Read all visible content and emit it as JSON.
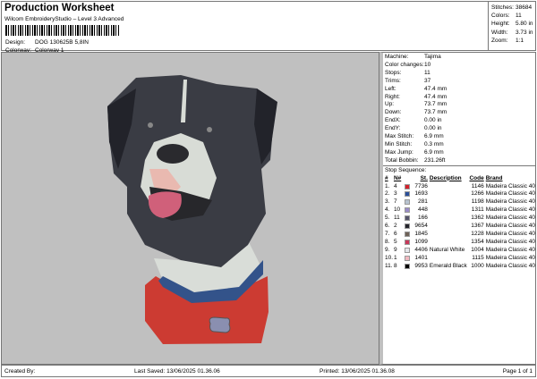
{
  "header": {
    "title": "Production Worksheet",
    "subtitle": "Wilcom EmbroideryStudio – Level 3 Advanced",
    "design_label": "Design:",
    "design_value": "DOG 130625B 5,8IN",
    "colorway_label": "Colorway:",
    "colorway_value": "Colorway 1"
  },
  "info": [
    {
      "k": "Stitches:",
      "v": "38684"
    },
    {
      "k": "Colors:",
      "v": "11"
    },
    {
      "k": "Height:",
      "v": "5.80 in"
    },
    {
      "k": "Width:",
      "v": "3.73 in"
    },
    {
      "k": "Zoom:",
      "v": "1:1"
    }
  ],
  "props": [
    {
      "k": "Machine:",
      "v": "Tajima"
    },
    {
      "k": "Color changes:",
      "v": "10"
    },
    {
      "k": "Stops:",
      "v": "11"
    },
    {
      "k": "Trims:",
      "v": "37"
    },
    {
      "k": "Left:",
      "v": "47.4 mm"
    },
    {
      "k": "Right:",
      "v": "47.4 mm"
    },
    {
      "k": "Up:",
      "v": "73.7 mm"
    },
    {
      "k": "Down:",
      "v": "73.7 mm"
    },
    {
      "k": "EndX:",
      "v": "0.00 in"
    },
    {
      "k": "EndY:",
      "v": "0.00 in"
    },
    {
      "k": "Max Stitch:",
      "v": "6.9 mm"
    },
    {
      "k": "Min Stitch:",
      "v": "0.3 mm"
    },
    {
      "k": "Max Jump:",
      "v": "6.9 mm"
    },
    {
      "k": "Total Bobbin:",
      "v": "231.26ft"
    }
  ],
  "stop_sequence": {
    "title": "Stop Sequence:",
    "headers": [
      "#",
      "N#",
      "St.",
      "Description",
      "Code",
      "Brand"
    ],
    "rows": [
      {
        "n": "1.",
        "nn": "4",
        "color": "#d4202a",
        "st": "7736",
        "desc": "",
        "code": "1146",
        "brand": "Madeira Classic 40"
      },
      {
        "n": "2.",
        "nn": "3",
        "color": "#2a4f9a",
        "st": "1693",
        "desc": "",
        "code": "1266",
        "brand": "Madeira Classic 40"
      },
      {
        "n": "3.",
        "nn": "7",
        "color": "#b8c4d0",
        "st": "281",
        "desc": "",
        "code": "1198",
        "brand": "Madeira Classic 40"
      },
      {
        "n": "4.",
        "nn": "10",
        "color": "#9a8cc8",
        "st": "448",
        "desc": "",
        "code": "1311",
        "brand": "Madeira Classic 40"
      },
      {
        "n": "5.",
        "nn": "11",
        "color": "#55546a",
        "st": "166",
        "desc": "",
        "code": "1362",
        "brand": "Madeira Classic 40"
      },
      {
        "n": "6.",
        "nn": "2",
        "color": "#23232b",
        "st": "9654",
        "desc": "",
        "code": "1367",
        "brand": "Madeira Classic 40"
      },
      {
        "n": "7.",
        "nn": "6",
        "color": "#6e6258",
        "st": "1845",
        "desc": "",
        "code": "1228",
        "brand": "Madeira Classic 40"
      },
      {
        "n": "8.",
        "nn": "5",
        "color": "#c8385a",
        "st": "1099",
        "desc": "",
        "code": "1354",
        "brand": "Madeira Classic 40"
      },
      {
        "n": "9.",
        "nn": "9",
        "color": "#e4e6ea",
        "st": "4406",
        "desc": "Natural White",
        "code": "1004",
        "brand": "Madeira Classic 40"
      },
      {
        "n": "10.",
        "nn": "1",
        "color": "#f0b8c0",
        "st": "1401",
        "desc": "",
        "code": "1115",
        "brand": "Madeira Classic 40"
      },
      {
        "n": "11.",
        "nn": "8",
        "color": "#000000",
        "st": "9953",
        "desc": "Emerald Black",
        "code": "1000",
        "brand": "Madeira Classic 40"
      }
    ]
  },
  "footer": {
    "created": "Created By:",
    "saved": "Last Saved: 13/06/2025 01.36.06",
    "printed": "Printed: 13/06/2025 01.36.08",
    "page": "Page 1 of 1"
  }
}
